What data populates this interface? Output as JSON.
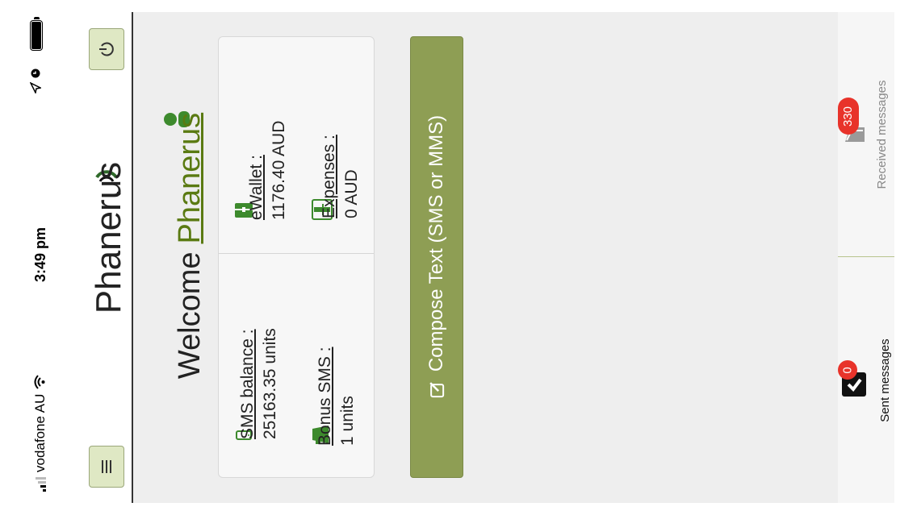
{
  "status_bar": {
    "carrier": "vodafone AU",
    "time": "3:49 pm"
  },
  "header": {
    "app_name": "Phanerus",
    "menu_icon": "hamburger-icon",
    "power_icon": "power-icon"
  },
  "main": {
    "welcome_text": "Welcome",
    "user_name": "Phanerus",
    "stats": {
      "sms_balance_label": "SMS balance :",
      "sms_balance_value": "25163.35 units",
      "bonus_sms_label": "Bonus SMS :",
      "bonus_sms_value": "1 units",
      "ewallet_label": "eWallet :",
      "ewallet_value": "1176.40 AUD",
      "expenses_label": "Expenses :",
      "expenses_value": "0 AUD"
    },
    "compose_button": "Compose Text (SMS or MMS)"
  },
  "tabs": [
    {
      "label": "Sent messages",
      "badge": "0",
      "icon": "sent-icon"
    },
    {
      "label": "Received messages",
      "badge": "330",
      "icon": "received-icon"
    }
  ],
  "colors": {
    "accent": "#5a7a12",
    "compose_bg": "#8e9e54",
    "badge": "#e8332a",
    "header_btn": "#dfe8c4"
  }
}
